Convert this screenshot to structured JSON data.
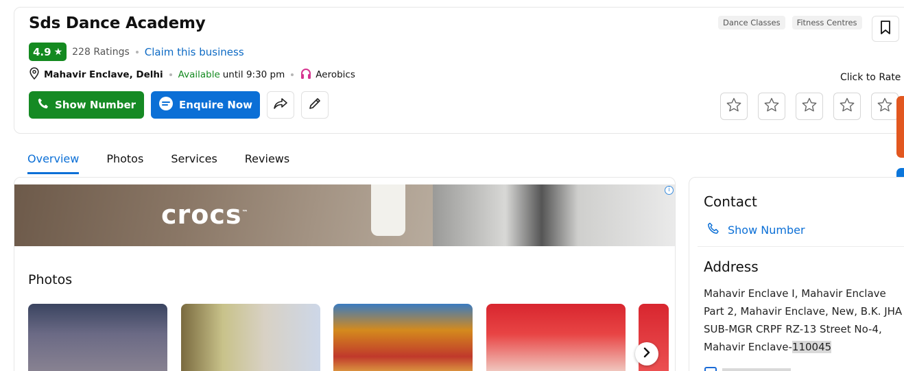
{
  "business": {
    "name": "Sds Dance Academy",
    "rating": "4.9",
    "rating_star": "★",
    "ratings_count": "228 Ratings",
    "claim": "Claim this business",
    "location": "Mahavir Enclave, Delhi",
    "available": "Available",
    "until": "until 9:30 pm",
    "category": "Aerobics"
  },
  "actions": {
    "show_number": "Show Number",
    "enquire": "Enquire Now"
  },
  "tags": [
    "Dance Classes",
    "Fitness Centres"
  ],
  "rate": {
    "label": "Click to Rate",
    "stars": 5
  },
  "tabs": [
    "Overview",
    "Photos",
    "Services",
    "Reviews"
  ],
  "ad": {
    "brand": "crocs",
    "trademark": "™"
  },
  "photos": {
    "title": "Photos"
  },
  "contact": {
    "heading": "Contact",
    "show_number": "Show Number"
  },
  "address": {
    "heading": "Address",
    "text": "Mahavir Enclave I, Mahavir Enclave Part 2, Mahavir Enclave, New, B.K. JHA SUB-MGR CRPF RZ-13 Street No-4, Mahavir Enclave-",
    "pin": "110045"
  },
  "colors": {
    "green": "#148a20",
    "blue": "#0b6fd6",
    "orange": "#e2571f"
  }
}
